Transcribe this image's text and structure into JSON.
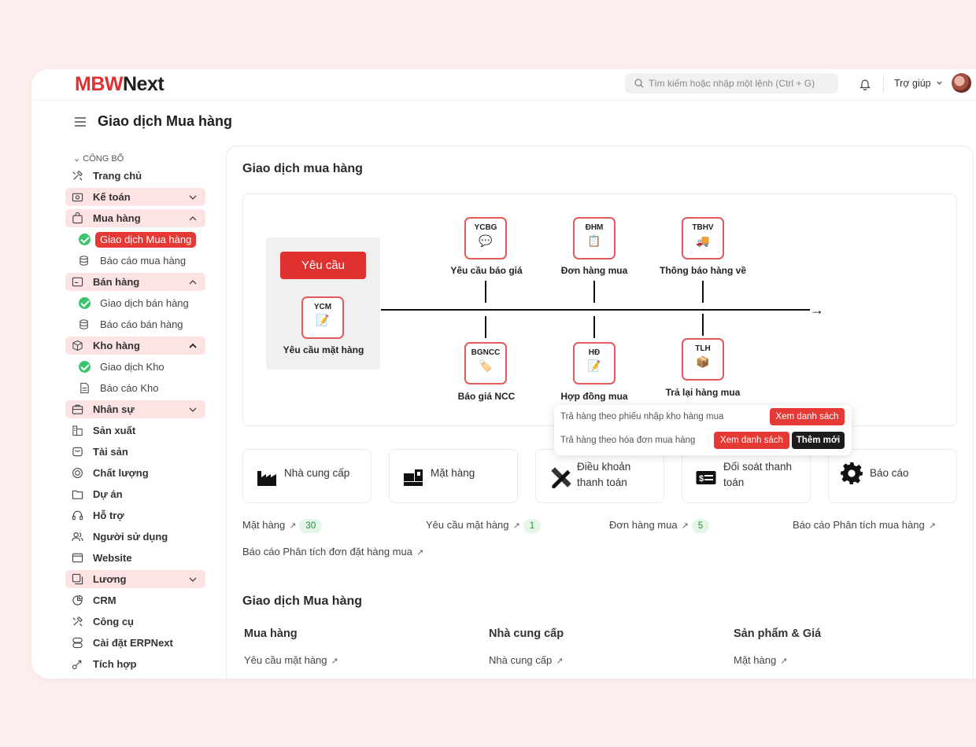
{
  "app": {
    "logo_red": "MBW",
    "logo_dark": "Next"
  },
  "topbar": {
    "search_placeholder": "Tìm kiếm hoặc nhập một lệnh (Ctrl + G)",
    "help_label": "Trợ giúp"
  },
  "page": {
    "title": "Giao dịch Mua hàng"
  },
  "sidebar": {
    "section_label": "CÔNG BỐ",
    "items": [
      {
        "label": "Trang chủ",
        "icon": "tools-icon"
      },
      {
        "label": "Kế toán",
        "icon": "wallet-icon"
      },
      {
        "label": "Mua hàng",
        "icon": "bag-icon"
      },
      {
        "label": "Giao dịch Mua hàng"
      },
      {
        "label": "Báo cáo mua hàng"
      },
      {
        "label": "Bán hàng",
        "icon": "receipt-icon"
      },
      {
        "label": "Giao dịch bán hàng"
      },
      {
        "label": "Báo cáo bán hàng"
      },
      {
        "label": "Kho hàng",
        "icon": "box-icon"
      },
      {
        "label": "Giao dịch Kho"
      },
      {
        "label": "Báo cáo Kho"
      },
      {
        "label": "Nhân sự",
        "icon": "briefcase-icon"
      },
      {
        "label": "Sản xuất",
        "icon": "factory-icon"
      },
      {
        "label": "Tài sản",
        "icon": "asset-icon"
      },
      {
        "label": "Chất lượng",
        "icon": "quality-icon"
      },
      {
        "label": "Dự án",
        "icon": "folder-icon"
      },
      {
        "label": "Hỗ trợ",
        "icon": "headset-icon"
      },
      {
        "label": "Người sử dụng",
        "icon": "users-icon"
      },
      {
        "label": "Website",
        "icon": "website-icon"
      },
      {
        "label": "Lương",
        "icon": "salary-icon"
      },
      {
        "label": "CRM",
        "icon": "crm-icon"
      },
      {
        "label": "Công cụ",
        "icon": "tools-icon"
      },
      {
        "label": "Cài đặt ERPNext",
        "icon": "settings-icon"
      },
      {
        "label": "Tích hợp",
        "icon": "integration-icon"
      }
    ]
  },
  "main": {
    "title": "Giao dịch mua hàng",
    "flow": {
      "request_button": "Yêu cầu",
      "nodes": [
        {
          "code": "YCM",
          "label": "Yêu cầu mặt hàng"
        },
        {
          "code": "YCBG",
          "label": "Yêu cầu báo giá"
        },
        {
          "code": "ĐHM",
          "label": "Đơn hàng mua"
        },
        {
          "code": "TBHV",
          "label": "Thông báo hàng về"
        },
        {
          "code": "BGNCC",
          "label": "Báo giá NCC"
        },
        {
          "code": "HĐ",
          "label": "Hợp đồng mua"
        },
        {
          "code": "TLH",
          "label": "Trả lại hàng mua"
        }
      ]
    },
    "popup": {
      "row1_text": "Trả hàng theo phiếu nhập kho hàng mua",
      "row1_btn": "Xem danh sách",
      "row2_text": "Trả hàng theo hóa đơn mua hàng",
      "row2_btn": "Xem danh sách",
      "row2_btn2": "Thêm mới"
    },
    "cards": [
      {
        "line1": "Nhà cung cấp",
        "line2": ""
      },
      {
        "line1": "Mặt hàng",
        "line2": ""
      },
      {
        "line1": "Điều khoản",
        "line2": "thanh toán"
      },
      {
        "line1": "Đối soát thanh",
        "line2": "toán"
      },
      {
        "line1": "Báo cáo",
        "line2": ""
      }
    ],
    "links": [
      {
        "label": "Mặt hàng",
        "count": "30"
      },
      {
        "label": "Yêu cầu mặt hàng",
        "count": "1"
      },
      {
        "label": "Đơn hàng mua",
        "count": "5"
      },
      {
        "label": "Báo cáo Phân tích mua hàng",
        "count": ""
      },
      {
        "label": "Báo cáo Phân tích đơn đặt hàng mua",
        "count": ""
      }
    ],
    "section2": {
      "title": "Giao dịch Mua hàng",
      "columns": [
        {
          "header": "Mua hàng",
          "link": "Yêu cầu mặt hàng"
        },
        {
          "header": "Nhà cung cấp",
          "link": "Nhà cung cấp"
        },
        {
          "header": "Sản phẩm & Giá",
          "link": "Mặt hàng"
        }
      ]
    }
  }
}
